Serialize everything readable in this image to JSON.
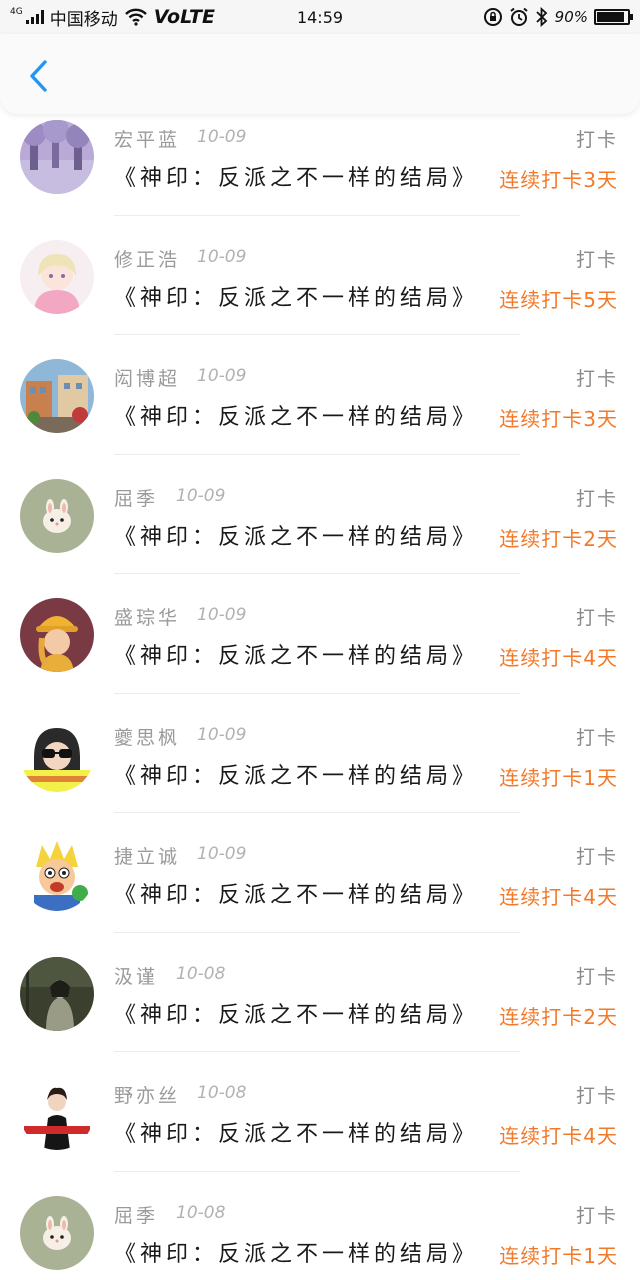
{
  "status_bar": {
    "network_gen": "4G",
    "carrier": "中国移动",
    "volte": "VoLTE",
    "time": "14:59",
    "battery_text": "90%",
    "battery_level": 0.9
  },
  "header": {
    "back_icon": "chevron-left-icon",
    "accent_color": "#2196f3"
  },
  "colors": {
    "streak": "#f2792a",
    "name": "#9a9a9a"
  },
  "list": [
    {
      "name": "宏平蓝",
      "date": "10-09",
      "action": "打卡",
      "book": "《神印：反派之不一样的结局》",
      "streak": "连续打卡3天",
      "avatar": "purple-trees-avatar"
    },
    {
      "name": "修正浩",
      "date": "10-09",
      "action": "打卡",
      "book": "《神印：反派之不一样的结局》",
      "streak": "连续打卡5天",
      "avatar": "anime-girl-avatar"
    },
    {
      "name": "闳博超",
      "date": "10-09",
      "action": "打卡",
      "book": "《神印：反派之不一样的结局》",
      "streak": "连续打卡3天",
      "avatar": "street-scene-avatar"
    },
    {
      "name": "屈季",
      "date": "10-09",
      "action": "打卡",
      "book": "《神印：反派之不一样的结局》",
      "streak": "连续打卡2天",
      "avatar": "bunny-avatar"
    },
    {
      "name": "盛琮华",
      "date": "10-09",
      "action": "打卡",
      "book": "《神印：反派之不一样的结局》",
      "streak": "连续打卡4天",
      "avatar": "yellow-hat-avatar"
    },
    {
      "name": "夔思枫",
      "date": "10-09",
      "action": "打卡",
      "book": "《神印：反派之不一样的结局》",
      "streak": "连续打卡1天",
      "avatar": "sunglasses-avatar"
    },
    {
      "name": "捷立诚",
      "date": "10-09",
      "action": "打卡",
      "book": "《神印：反派之不一样的结局》",
      "streak": "连续打卡4天",
      "avatar": "cartoon-avatar"
    },
    {
      "name": "汲谨",
      "date": "10-08",
      "action": "打卡",
      "book": "《神印：反派之不一样的结局》",
      "streak": "连续打卡2天",
      "avatar": "dark-photo-avatar"
    },
    {
      "name": "野亦丝",
      "date": "10-08",
      "action": "打卡",
      "book": "《神印：反派之不一样的结局》",
      "streak": "连续打卡4天",
      "avatar": "woman-black-dress-avatar"
    },
    {
      "name": "屈季",
      "date": "10-08",
      "action": "打卡",
      "book": "《神印：反派之不一样的结局》",
      "streak": "连续打卡1天",
      "avatar": "bunny-avatar"
    }
  ]
}
